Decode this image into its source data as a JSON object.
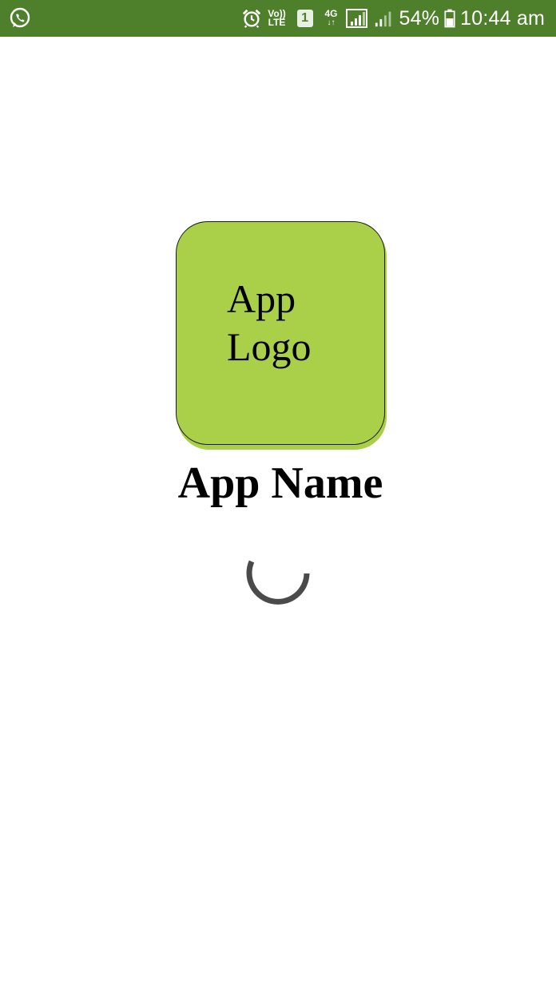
{
  "status_bar": {
    "icons": [
      "whatsapp-icon",
      "alarm-icon",
      "volte-icon",
      "sim-1-icon",
      "4g-data-icon",
      "signal-sim1-icon",
      "signal-sim2-icon",
      "battery-icon"
    ],
    "volte_top": "Vo))",
    "volte_bottom": "LTE",
    "sim_number": "1",
    "network_type": "4G",
    "battery_percent": "54%",
    "time": "10:44 am",
    "background_color": "#4e7f2a"
  },
  "splash": {
    "logo_line_1": "App",
    "logo_line_2": "Logo",
    "logo_color": "#aad04a",
    "app_name": "App Name"
  },
  "loading": {
    "indicator": "spinner-icon"
  }
}
